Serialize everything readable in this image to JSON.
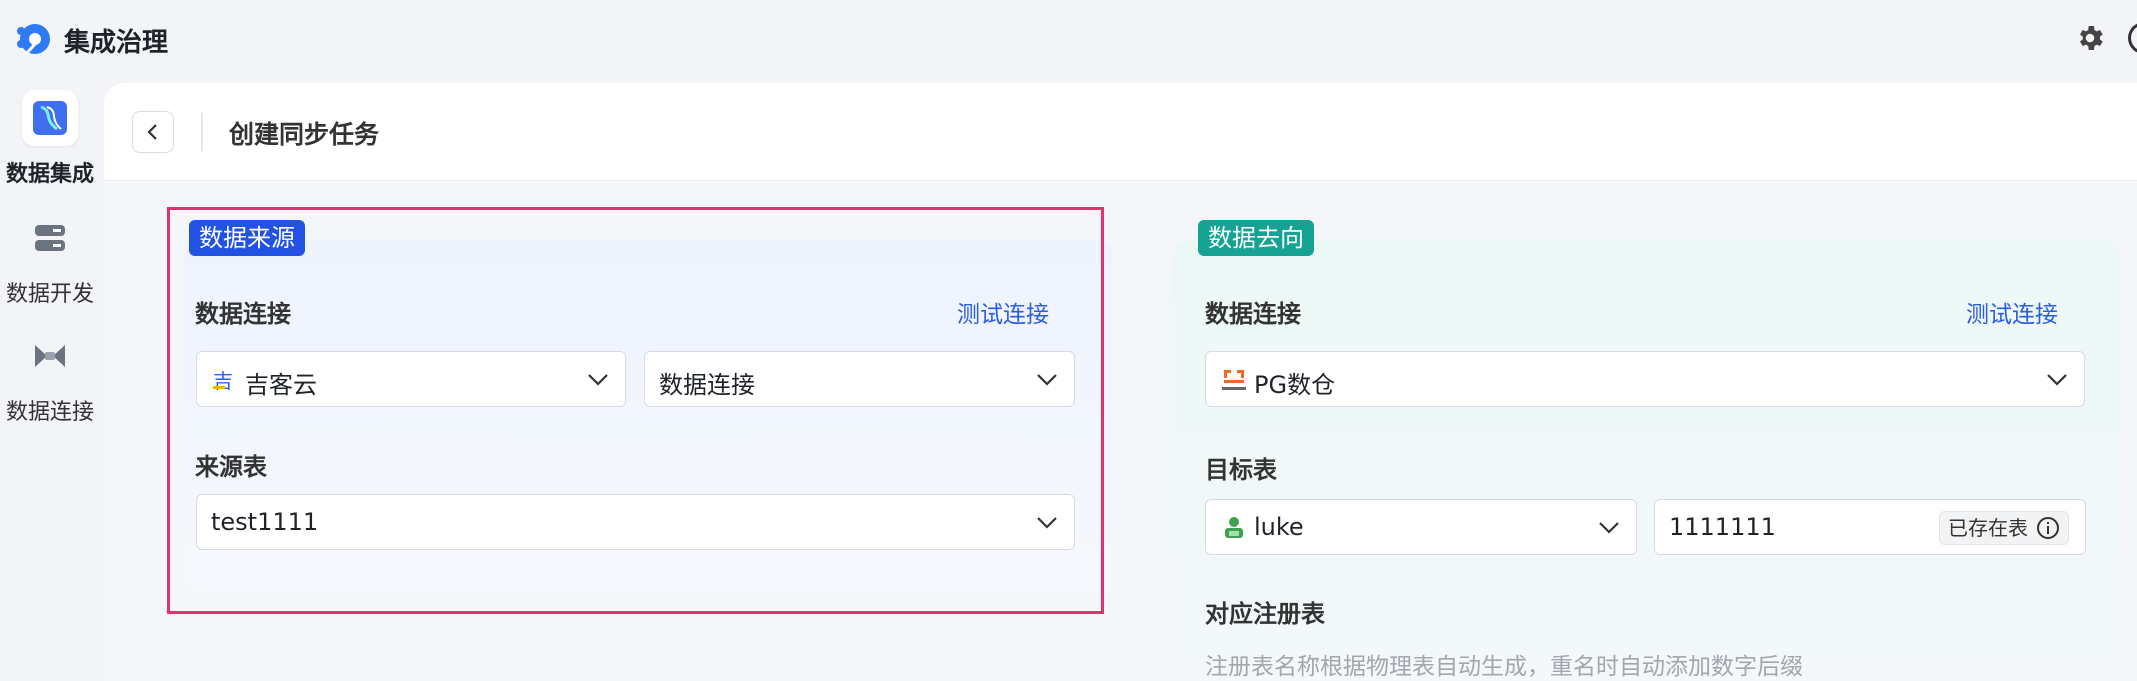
{
  "app": {
    "title": "集成治理"
  },
  "nav": [
    {
      "label": "数据集成",
      "icon": "data-integration-icon",
      "active": true
    },
    {
      "label": "数据开发",
      "icon": "data-development-icon",
      "active": false
    },
    {
      "label": "数据连接",
      "icon": "data-connection-icon",
      "active": false
    }
  ],
  "page": {
    "title": "创建同步任务"
  },
  "source": {
    "tag": "数据来源",
    "connection_label": "数据连接",
    "test_link": "测试连接",
    "platform_select": "吉客云",
    "connection_select": "数据连接",
    "table_label": "来源表",
    "table_select": "test1111"
  },
  "destination": {
    "tag": "数据去向",
    "connection_label": "数据连接",
    "test_link": "测试连接",
    "connection_select": "PG数仓",
    "target_label": "目标表",
    "schema_select": "luke",
    "table_input": "1111111",
    "exists_badge": "已存在表",
    "register_label": "对应注册表",
    "register_hint": "注册表名称根据物理表自动生成，重名时自动添加数字后缀"
  },
  "colors": {
    "source_tag": "#2152e4",
    "destination_tag": "#16a394",
    "link": "#2a5ce6",
    "highlight_border": "#e0336b"
  }
}
